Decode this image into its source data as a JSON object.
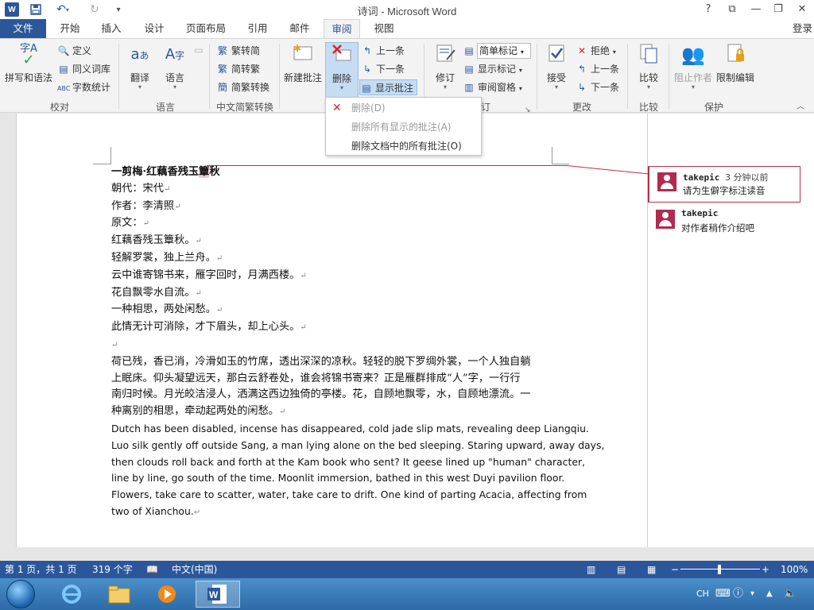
{
  "window": {
    "title": "诗词 - Microsoft Word",
    "controls": [
      "?",
      "⧉",
      "—",
      "❐",
      "✕"
    ]
  },
  "tabs": {
    "file": "文件",
    "items": [
      "开始",
      "插入",
      "设计",
      "页面布局",
      "引用",
      "邮件",
      "审阅",
      "视图"
    ],
    "active": "审阅",
    "login": "登录"
  },
  "ribbon": {
    "proofing": {
      "label": "校对",
      "spelling": "拼写和语法",
      "define": "定义",
      "thesaurus": "同义词库",
      "word_count": "字数统计"
    },
    "language": {
      "label": "语言",
      "translate": "翻译",
      "language": "语言"
    },
    "chinese_conversion": {
      "label": "中文简繁转换",
      "to_simplified": "繁转简",
      "to_traditional": "简转繁",
      "convert": "简繁转换"
    },
    "comments": {
      "new": "新建批注",
      "delete": "删除",
      "previous": "上一条",
      "next": "下一条",
      "show": "显示批注"
    },
    "tracking": {
      "label": "修订",
      "track": "修订",
      "markup_combo": "简单标记",
      "show_markup": "显示标记",
      "reviewing_pane": "审阅窗格"
    },
    "changes": {
      "label": "更改",
      "accept": "接受",
      "reject": "拒绝",
      "previous": "上一条",
      "next": "下一条"
    },
    "compare": {
      "label": "比较",
      "compare": "比较"
    },
    "protect": {
      "label": "保护",
      "block_authors": "阻止作者",
      "restrict": "限制编辑"
    }
  },
  "delete_menu": {
    "items": [
      {
        "label": "删除(D)",
        "enabled": false
      },
      {
        "label": "删除所有显示的批注(A)",
        "enabled": false
      },
      {
        "label": "删除文档中的所有批注(O)",
        "enabled": true
      }
    ]
  },
  "document": {
    "title_pre": "一剪梅·红藕香残玉",
    "title_hl": "簟",
    "title_post": "秋",
    "lines": [
      "朝代：宋代",
      "作者：李清照",
      "原文：",
      "红藕香残玉簟秋。",
      "轻解罗裳，独上兰舟。",
      "云中谁寄锦书来，雁字回时，月满西楼。",
      "花自飘零水自流。",
      "一种相思，两处闲愁。",
      "此情无计可消除，才下眉头，却上心头。"
    ],
    "paragraph_cn": [
      "荷已残，香已消，冷滑如玉的竹席，透出深深的凉秋。轻轻的脱下罗绸外裳，一个人独自躺",
      "上眠床。仰头凝望远天，那白云舒卷处，谁会将锦书寄来？正是雁群排成“人”字，一行行",
      "南归时候。月光皎洁浸人，洒满这西边独倚的亭楼。花，自顾地飘零，水，自顾地漂流。一",
      "种离别的相思，牵动起两处的闲愁。"
    ],
    "paragraph_en": [
      "Dutch has been disabled, incense has disappeared, cold jade slip mats, revealing deep Liangqiu.",
      "Luo silk gently off outside Sang, a man lying alone on the bed sleeping. Staring upward, away days,",
      "then clouds roll back and forth at the Kam book who sent? It geese lined up \"human\" character,",
      "line by line, go south of the time. Moonlit immersion, bathed in this west Duyi pavilion floor.",
      "Flowers, take care to scatter, water, take care to drift. One kind of parting Acacia, affecting from",
      "two of Xianchou."
    ],
    "paragraph_mark": "↵"
  },
  "comments": [
    {
      "author": "takepic",
      "time": "3 分钟以前",
      "text": "请为生僻字标注读音"
    },
    {
      "author": "takepic",
      "time": "",
      "text": "对作者稍作介绍吧"
    }
  ],
  "statusbar": {
    "page": "第 1 页，共 1 页",
    "words": "319 个字",
    "language": "中文(中国)",
    "zoom": "100%",
    "zoom_level": 1.0
  },
  "taskbar": {
    "tray_lang": "CH",
    "apps": [
      "ie-icon",
      "explorer-icon",
      "media-player-icon",
      "word-icon"
    ]
  },
  "colors": {
    "word_blue": "#2b579a",
    "comment_accent": "#b4324b",
    "selected_button": "#c5dcf3"
  }
}
